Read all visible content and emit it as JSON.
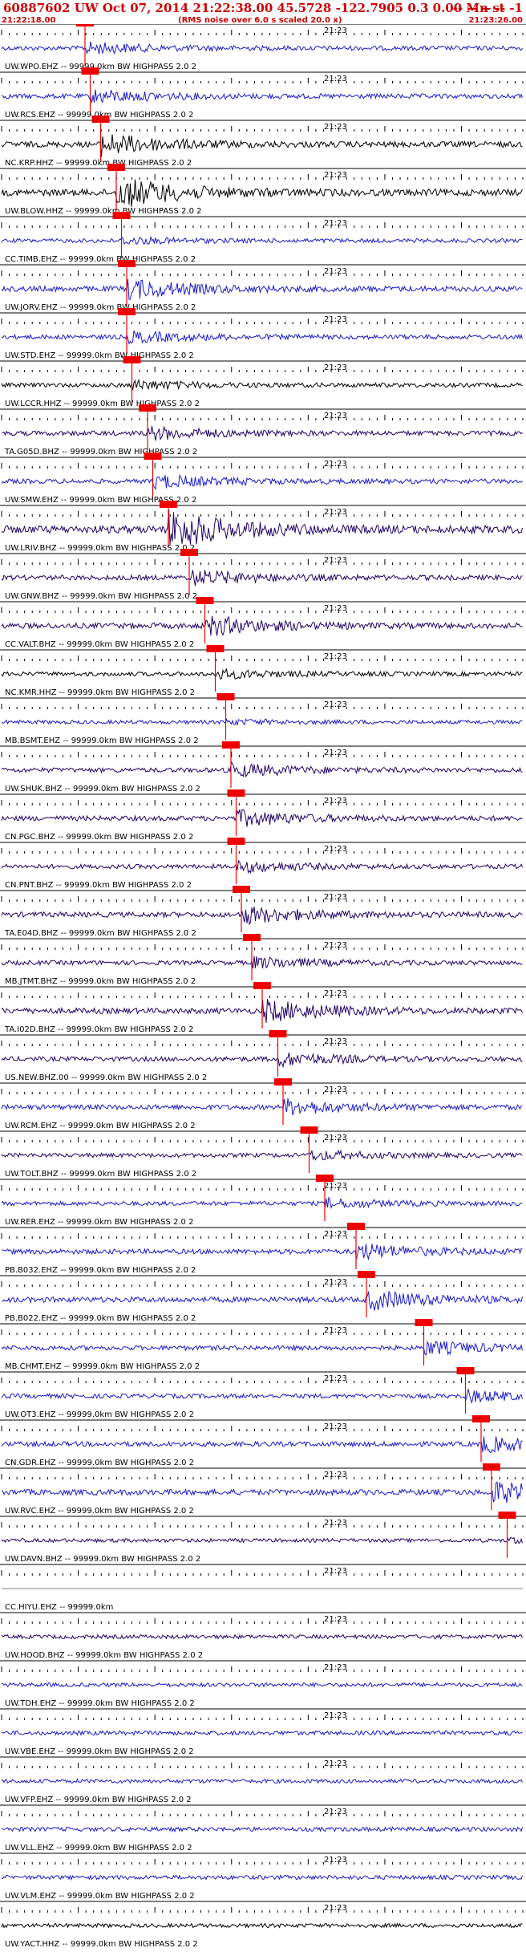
{
  "header": {
    "title": "60887602 UW Oct 07, 2014 21:22:38.00   45.5728 -122.7905  0.3 0.00 Mn st",
    "title_right": "-- -- -- --   -1",
    "start_time": "21:22:18.00",
    "note": "(RMS noise over 6.0 s scaled 20.0 x)",
    "end_time": "21:23:26.00"
  },
  "chart_data": {
    "type": "line",
    "title": "60887602 UW Oct 07, 2014 21:22:38.00   45.5728 -122.7905  0.3 0.00 Mn st",
    "time_start": "21:22:18.00",
    "time_end": "21:23:26.00",
    "mid_tick_label": "21:23",
    "colors": {
      "blue": "#1a1acc",
      "navy": "#220066",
      "black": "#000000",
      "pick": "#ee0000"
    },
    "traces": [
      {
        "label": "UW.WPO.EHZ -- 99999.0km BW  HIGHPASS  2.0  2",
        "color": "blue",
        "pick": 0.16,
        "amp": 0.25
      },
      {
        "label": "UW.RCS.EHZ -- 99999.0km BW  HIGHPASS  2.0  2",
        "color": "blue",
        "pick": 0.17,
        "amp": 0.3
      },
      {
        "label": "NC.KRP.HHZ -- 99999.0km BW  HIGHPASS  2.0  2",
        "color": "black",
        "pick": 0.19,
        "amp": 0.5
      },
      {
        "label": "UW.BLOW.HHZ -- 99999.0km BW  HIGHPASS  2.0  2",
        "color": "black",
        "pick": 0.22,
        "amp": 0.7
      },
      {
        "label": "CC.TIMB.EHZ -- 99999.0km BW  HIGHPASS  2.0  2",
        "color": "blue",
        "pick": 0.23,
        "amp": 0.15
      },
      {
        "label": "UW.JORV.EHZ -- 99999.0km BW  HIGHPASS  2.0  2",
        "color": "blue",
        "pick": 0.24,
        "amp": 0.45
      },
      {
        "label": "UW.STD.EHZ -- 99999.0km BW  HIGHPASS  2.0  2",
        "color": "blue",
        "pick": 0.24,
        "amp": 0.25
      },
      {
        "label": "UW.LCCR.HHZ -- 99999.0km BW  HIGHPASS  2.0  2",
        "color": "black",
        "pick": 0.25,
        "amp": 0.2
      },
      {
        "label": "TA.G05D.BHZ -- 99999.0km BW  HIGHPASS  2.0  2",
        "color": "navy",
        "pick": 0.28,
        "amp": 0.3
      },
      {
        "label": "UW.SMW.EHZ -- 99999.0km BW  HIGHPASS  2.0  2",
        "color": "blue",
        "pick": 0.29,
        "amp": 0.3
      },
      {
        "label": "UW.LRIV.BHZ -- 99999.0km BW  HIGHPASS  2.0  2",
        "color": "navy",
        "pick": 0.32,
        "amp": 0.9
      },
      {
        "label": "UW.GNW.BHZ -- 99999.0km BW  HIGHPASS  2.0  2",
        "color": "navy",
        "pick": 0.36,
        "amp": 0.35
      },
      {
        "label": "CC.VALT.BHZ -- 99999.0km BW  HIGHPASS  2.0  2",
        "color": "navy",
        "pick": 0.39,
        "amp": 0.45
      },
      {
        "label": "NC.KMR.HHZ -- 99999.0km BW  HIGHPASS  2.0  2",
        "color": "black",
        "pick": 0.41,
        "amp": 0.2
      },
      {
        "label": "MB.BSMT.EHZ -- 99999.0km BW  HIGHPASS  2.0  2",
        "color": "blue",
        "pick": 0.43,
        "amp": 0.1
      },
      {
        "label": "UW.SHUK.BHZ -- 99999.0km BW  HIGHPASS  2.0  2",
        "color": "navy",
        "pick": 0.44,
        "amp": 0.3
      },
      {
        "label": "CN.PGC.BHZ -- 99999.0km BW  HIGHPASS  2.0  2",
        "color": "navy",
        "pick": 0.45,
        "amp": 0.35
      },
      {
        "label": "CN.PNT.BHZ -- 99999.0km BW  HIGHPASS  2.0  2",
        "color": "navy",
        "pick": 0.45,
        "amp": 0.25
      },
      {
        "label": "TA.E04D.BHZ -- 99999.0km BW  HIGHPASS  2.0  2",
        "color": "navy",
        "pick": 0.46,
        "amp": 0.4
      },
      {
        "label": "MB.JTMT.BHZ -- 99999.0km BW  HIGHPASS  2.0  2",
        "color": "navy",
        "pick": 0.48,
        "amp": 0.25
      },
      {
        "label": "TA.I02D.BHZ -- 99999.0km BW  HIGHPASS  2.0  2",
        "color": "navy",
        "pick": 0.5,
        "amp": 0.5
      },
      {
        "label": "US.NEW.BHZ.00 -- 99999.0km BW  HIGHPASS  2.0  2",
        "color": "navy",
        "pick": 0.53,
        "amp": 0.3
      },
      {
        "label": "UW.RCM.EHZ -- 99999.0km BW  HIGHPASS  2.0  2",
        "color": "blue",
        "pick": 0.54,
        "amp": 0.35
      },
      {
        "label": "UW.TOLT.BHZ -- 99999.0km BW  HIGHPASS  2.0  2",
        "color": "navy",
        "pick": 0.59,
        "amp": 0.2
      },
      {
        "label": "UW.RER.EHZ -- 99999.0km BW  HIGHPASS  2.0  2",
        "color": "blue",
        "pick": 0.62,
        "amp": 0.2
      },
      {
        "label": "PB.B032.EHZ -- 99999.0km BW  HIGHPASS  2.0  2",
        "color": "blue",
        "pick": 0.68,
        "amp": 0.35
      },
      {
        "label": "PB.B022.EHZ -- 99999.0km BW  HIGHPASS  2.0  2",
        "color": "blue",
        "pick": 0.7,
        "amp": 0.45
      },
      {
        "label": "MB.CHMT.EHZ -- 99999.0km BW  HIGHPASS  2.0  2",
        "color": "blue",
        "pick": 0.81,
        "amp": 0.3
      },
      {
        "label": "UW.OT3.EHZ -- 99999.0km BW  HIGHPASS  2.0  2",
        "color": "blue",
        "pick": 0.89,
        "amp": 0.25
      },
      {
        "label": "CN.GDR.EHZ -- 99999.0km BW  HIGHPASS  2.0  2",
        "color": "blue",
        "pick": 0.92,
        "amp": 0.35
      },
      {
        "label": "UW.RVC.EHZ -- 99999.0km BW  HIGHPASS  2.0  2",
        "color": "blue",
        "pick": 0.94,
        "amp": 0.5
      },
      {
        "label": "UW.DAVN.BHZ -- 99999.0km BW  HIGHPASS  2.0  2",
        "color": "navy",
        "pick": 0.97,
        "amp": 0.1
      },
      {
        "label": "CC.HIYU.EHZ -- 99999.0km",
        "color": "black",
        "pick": null,
        "amp": 0.0
      },
      {
        "label": "UW.HOOD.BHZ -- 99999.0km BW  HIGHPASS  2.0  2",
        "color": "navy",
        "pick": null,
        "amp": 0.15
      },
      {
        "label": "UW.TDH.EHZ -- 99999.0km BW  HIGHPASS  2.0  2",
        "color": "blue",
        "pick": null,
        "amp": 0.15
      },
      {
        "label": "UW.VBE.EHZ -- 99999.0km BW  HIGHPASS  2.0  2",
        "color": "blue",
        "pick": null,
        "amp": 0.2
      },
      {
        "label": "UW.VFP.EHZ -- 99999.0km BW  HIGHPASS  2.0  2",
        "color": "blue",
        "pick": null,
        "amp": 0.15
      },
      {
        "label": "UW.VLL.EHZ -- 99999.0km BW  HIGHPASS  2.0  2",
        "color": "blue",
        "pick": null,
        "amp": 0.2
      },
      {
        "label": "UW.VLM.EHZ -- 99999.0km BW  HIGHPASS  2.0  2",
        "color": "blue",
        "pick": null,
        "amp": 0.2
      },
      {
        "label": "UW.YACT.HHZ -- 99999.0km BW  HIGHPASS  2.0  2",
        "color": "black",
        "pick": null,
        "amp": 0.15
      }
    ]
  }
}
